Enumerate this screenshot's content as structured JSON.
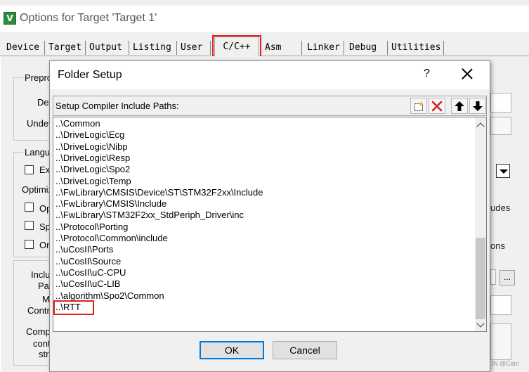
{
  "window": {
    "title": "Options for Target 'Target 1'",
    "tabs": [
      "Device",
      "Target",
      "Output",
      "Listing",
      "User",
      "C/C++",
      "Asm",
      "Linker",
      "Debug",
      "Utilities"
    ],
    "active_tab": "C/C++"
  },
  "background": {
    "preprocessor_group": "Prepro",
    "define_label": "Def",
    "undefine_label": "Undef",
    "language_group": "Langu",
    "execute_only_label": "Ex",
    "optimization_label": "Optimiz",
    "opt_checkbox_1": "Op",
    "opt_checkbox_2": "Sp",
    "opt_checkbox_3": "On",
    "include_paths_label_1": "Inclu",
    "include_paths_label_2": "Pat",
    "misc_controls_label_1": "Mi",
    "misc_controls_label_2": "Contr",
    "compiler_control_label_1": "Comp",
    "compiler_control_label_2": "cont",
    "compiler_control_label_3": "stri",
    "includes_fragment": "udes",
    "options_fragment": "ons",
    "browse_button": "...",
    "watermark": "CSDN @Can!"
  },
  "dialog": {
    "title": "Folder Setup",
    "help": "?",
    "paths_label": "Setup Compiler Include Paths:",
    "toolbar": {
      "new_icon": "new-folder-icon",
      "delete_icon": "delete-icon",
      "up_icon": "move-up-icon",
      "down_icon": "move-down-icon"
    },
    "paths": [
      "..\\Common",
      "..\\DriveLogic\\Ecg",
      "..\\DriveLogic\\Nibp",
      "..\\DriveLogic\\Resp",
      "..\\DriveLogic\\Spo2",
      "..\\DriveLogic\\Temp",
      "..\\FwLibrary\\CMSIS\\Device\\ST\\STM32F2xx\\Include",
      "..\\FwLibrary\\CMSIS\\Include",
      "..\\FwLibrary\\STM32F2xx_StdPeriph_Driver\\inc",
      "..\\Protocol\\Porting",
      "..\\Protocol\\Common\\include",
      "..\\uCosII\\Ports",
      "..\\uCosII\\Source",
      "..\\uCosII\\uC-CPU",
      "..\\uCosII\\uC-LIB",
      "..\\algorithm\\Spo2\\Common",
      "..\\RTT"
    ],
    "ok_label": "OK",
    "cancel_label": "Cancel"
  }
}
